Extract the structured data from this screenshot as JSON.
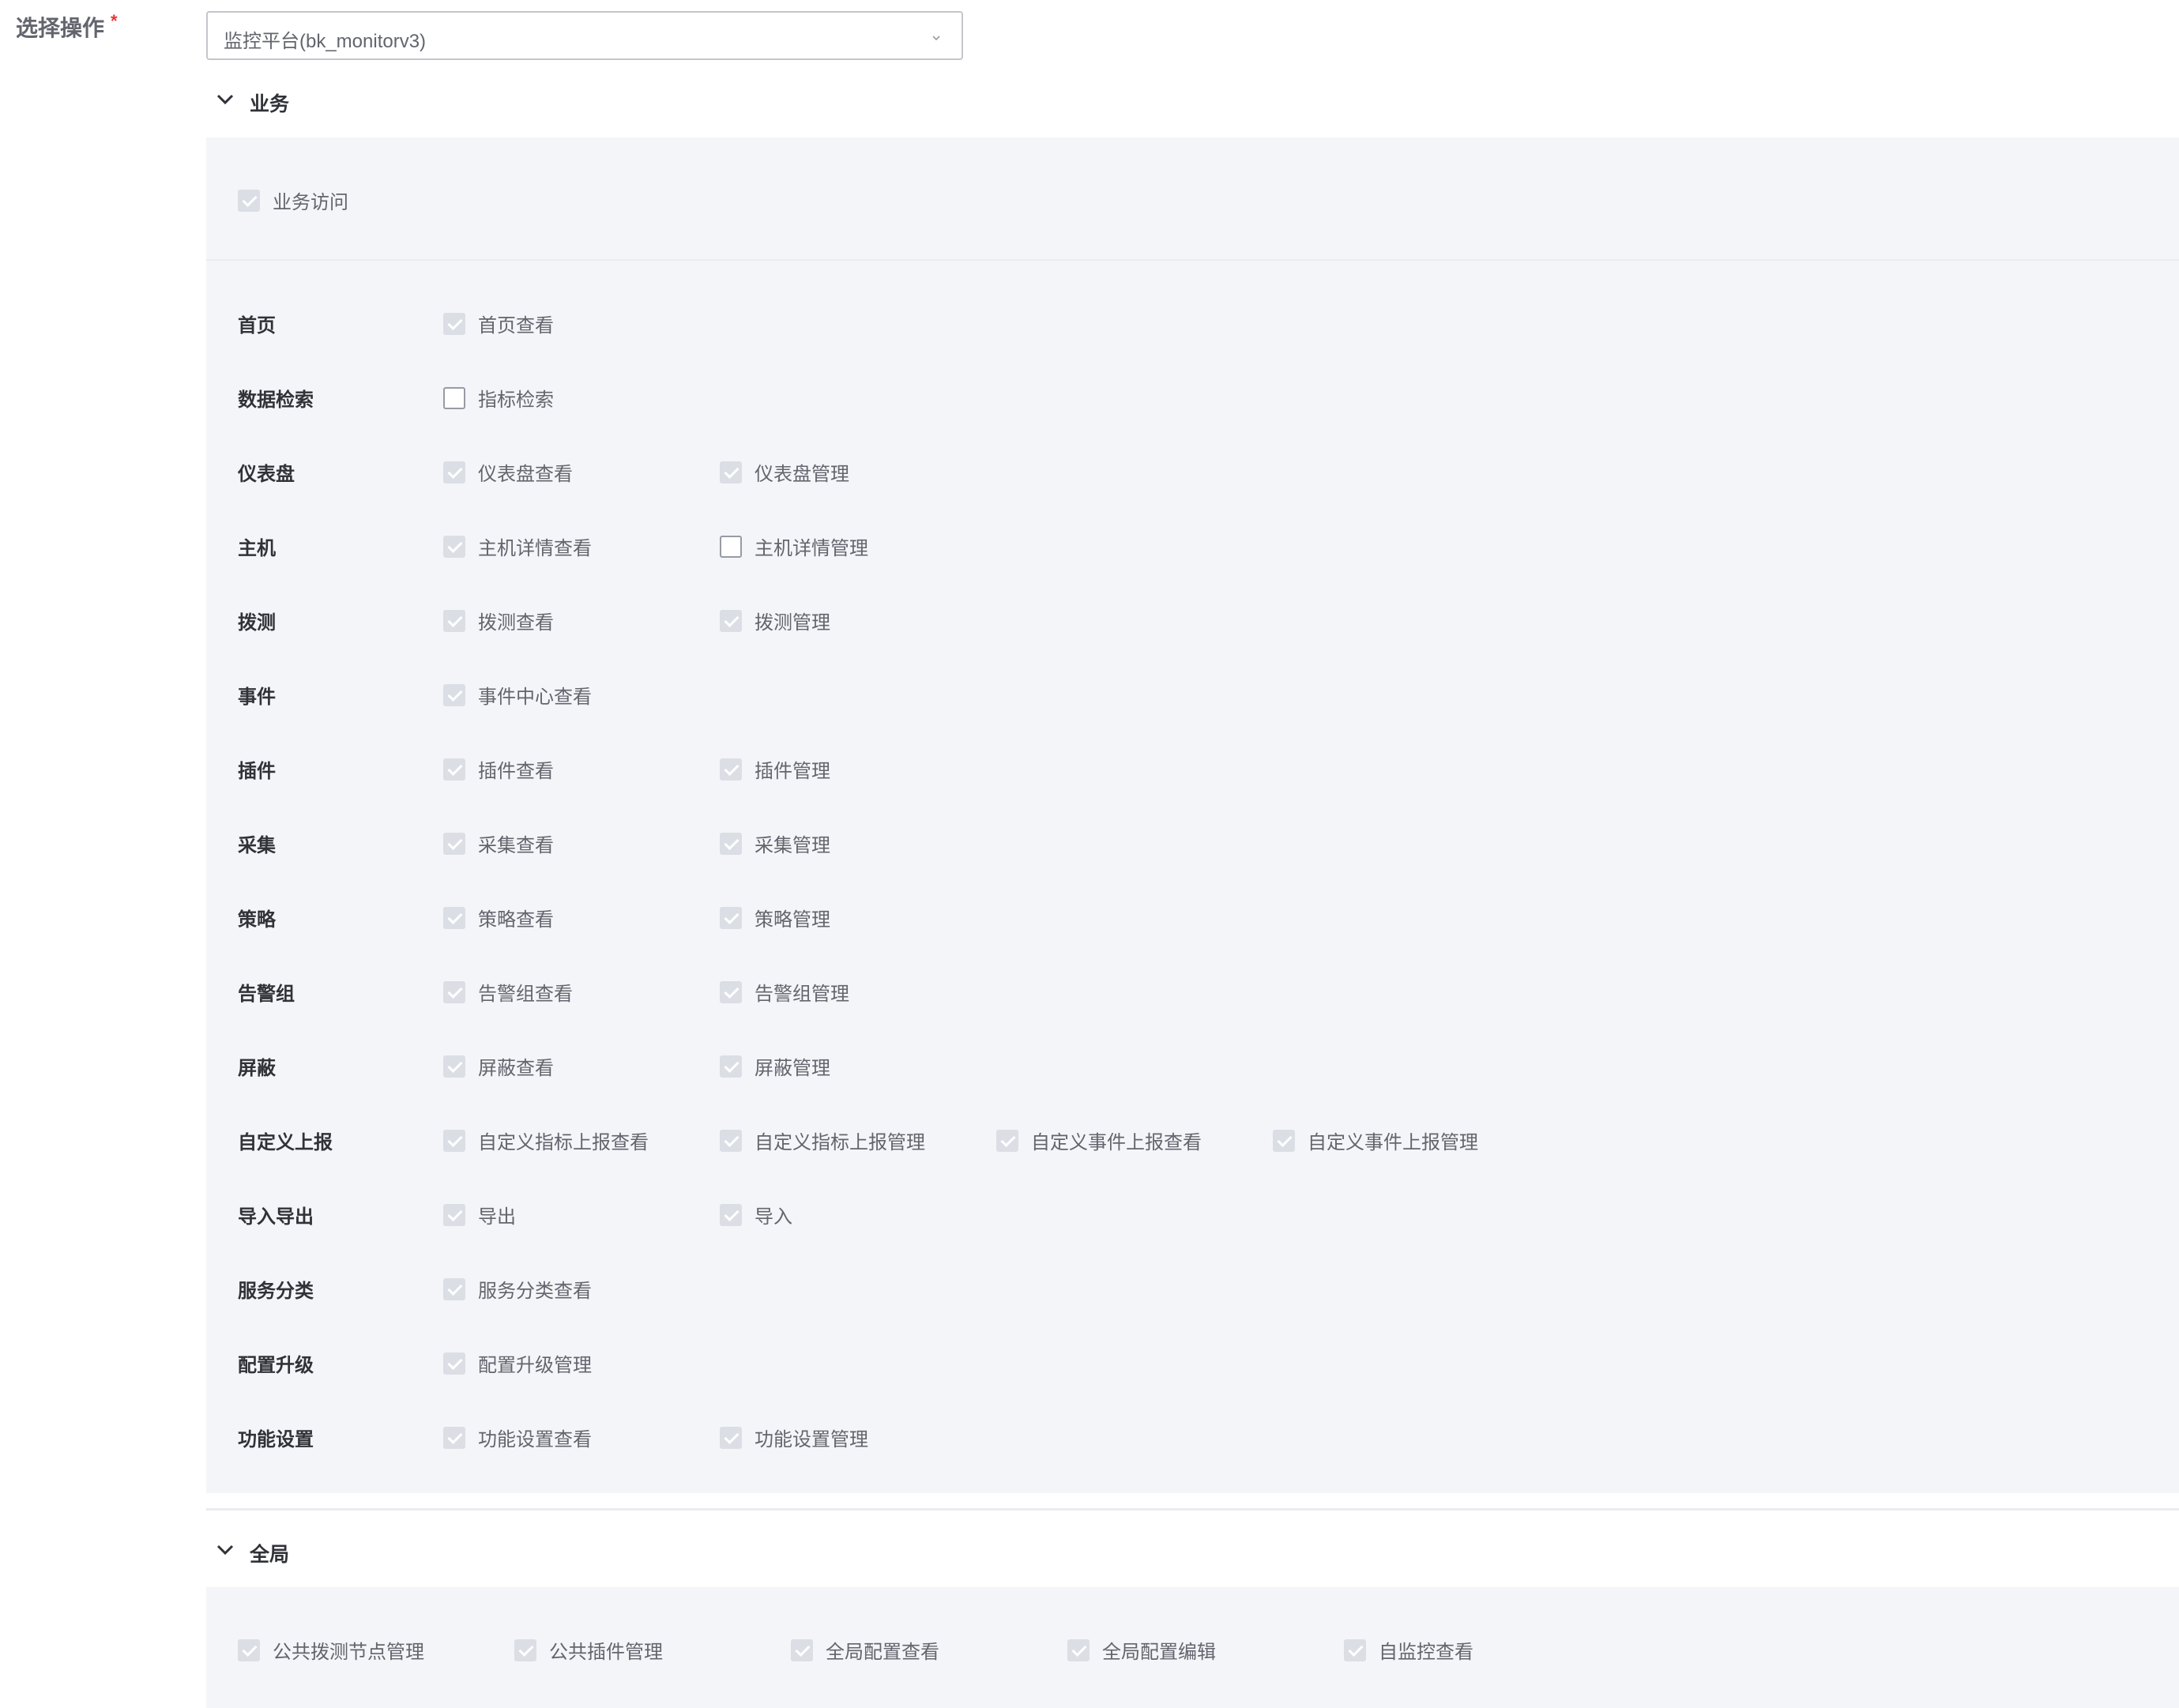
{
  "form": {
    "label": "选择操作",
    "required_mark": "*",
    "select_value": "监控平台(bk_monitorv3)"
  },
  "business": {
    "title": "业务",
    "access": {
      "label": "业务访问",
      "checked": true
    },
    "rows": [
      {
        "label": "首页",
        "items": [
          {
            "label": "首页查看",
            "checked": true
          }
        ]
      },
      {
        "label": "数据检索",
        "items": [
          {
            "label": "指标检索",
            "checked": false
          }
        ]
      },
      {
        "label": "仪表盘",
        "items": [
          {
            "label": "仪表盘查看",
            "checked": true
          },
          {
            "label": "仪表盘管理",
            "checked": true
          }
        ]
      },
      {
        "label": "主机",
        "items": [
          {
            "label": "主机详情查看",
            "checked": true
          },
          {
            "label": "主机详情管理",
            "checked": false
          }
        ]
      },
      {
        "label": "拨测",
        "items": [
          {
            "label": "拨测查看",
            "checked": true
          },
          {
            "label": "拨测管理",
            "checked": true
          }
        ]
      },
      {
        "label": "事件",
        "items": [
          {
            "label": "事件中心查看",
            "checked": true
          }
        ]
      },
      {
        "label": "插件",
        "items": [
          {
            "label": "插件查看",
            "checked": true
          },
          {
            "label": "插件管理",
            "checked": true
          }
        ]
      },
      {
        "label": "采集",
        "items": [
          {
            "label": "采集查看",
            "checked": true
          },
          {
            "label": "采集管理",
            "checked": true
          }
        ]
      },
      {
        "label": "策略",
        "items": [
          {
            "label": "策略查看",
            "checked": true
          },
          {
            "label": "策略管理",
            "checked": true
          }
        ]
      },
      {
        "label": "告警组",
        "items": [
          {
            "label": "告警组查看",
            "checked": true
          },
          {
            "label": "告警组管理",
            "checked": true
          }
        ]
      },
      {
        "label": "屏蔽",
        "items": [
          {
            "label": "屏蔽查看",
            "checked": true
          },
          {
            "label": "屏蔽管理",
            "checked": true
          }
        ]
      },
      {
        "label": "自定义上报",
        "items": [
          {
            "label": "自定义指标上报查看",
            "checked": true
          },
          {
            "label": "自定义指标上报管理",
            "checked": true
          },
          {
            "label": "自定义事件上报查看",
            "checked": true
          },
          {
            "label": "自定义事件上报管理",
            "checked": true
          }
        ]
      },
      {
        "label": "导入导出",
        "items": [
          {
            "label": "导出",
            "checked": true
          },
          {
            "label": "导入",
            "checked": true
          }
        ]
      },
      {
        "label": "服务分类",
        "items": [
          {
            "label": "服务分类查看",
            "checked": true
          }
        ]
      },
      {
        "label": "配置升级",
        "items": [
          {
            "label": "配置升级管理",
            "checked": true
          }
        ]
      },
      {
        "label": "功能设置",
        "items": [
          {
            "label": "功能设置查看",
            "checked": true
          },
          {
            "label": "功能设置管理",
            "checked": true
          }
        ]
      }
    ]
  },
  "global": {
    "title": "全局",
    "items": [
      {
        "label": "公共拨测节点管理",
        "checked": true
      },
      {
        "label": "公共插件管理",
        "checked": true
      },
      {
        "label": "全局配置查看",
        "checked": true
      },
      {
        "label": "全局配置编辑",
        "checked": true
      },
      {
        "label": "自监控查看",
        "checked": true
      }
    ]
  },
  "icons": {
    "select_arrow": "chevron-down-icon",
    "group_toggle": "chevron-down-icon",
    "checked_box": "checkbox-checked-icon",
    "unchecked_box": "checkbox-unchecked-icon"
  },
  "colors": {
    "panel_bg": "#f4f5f8",
    "checked_box": "#dcdee5",
    "unchecked_border": "#979ba5",
    "required": "#ea3636",
    "text": "#63656e",
    "title_text": "#313238"
  }
}
